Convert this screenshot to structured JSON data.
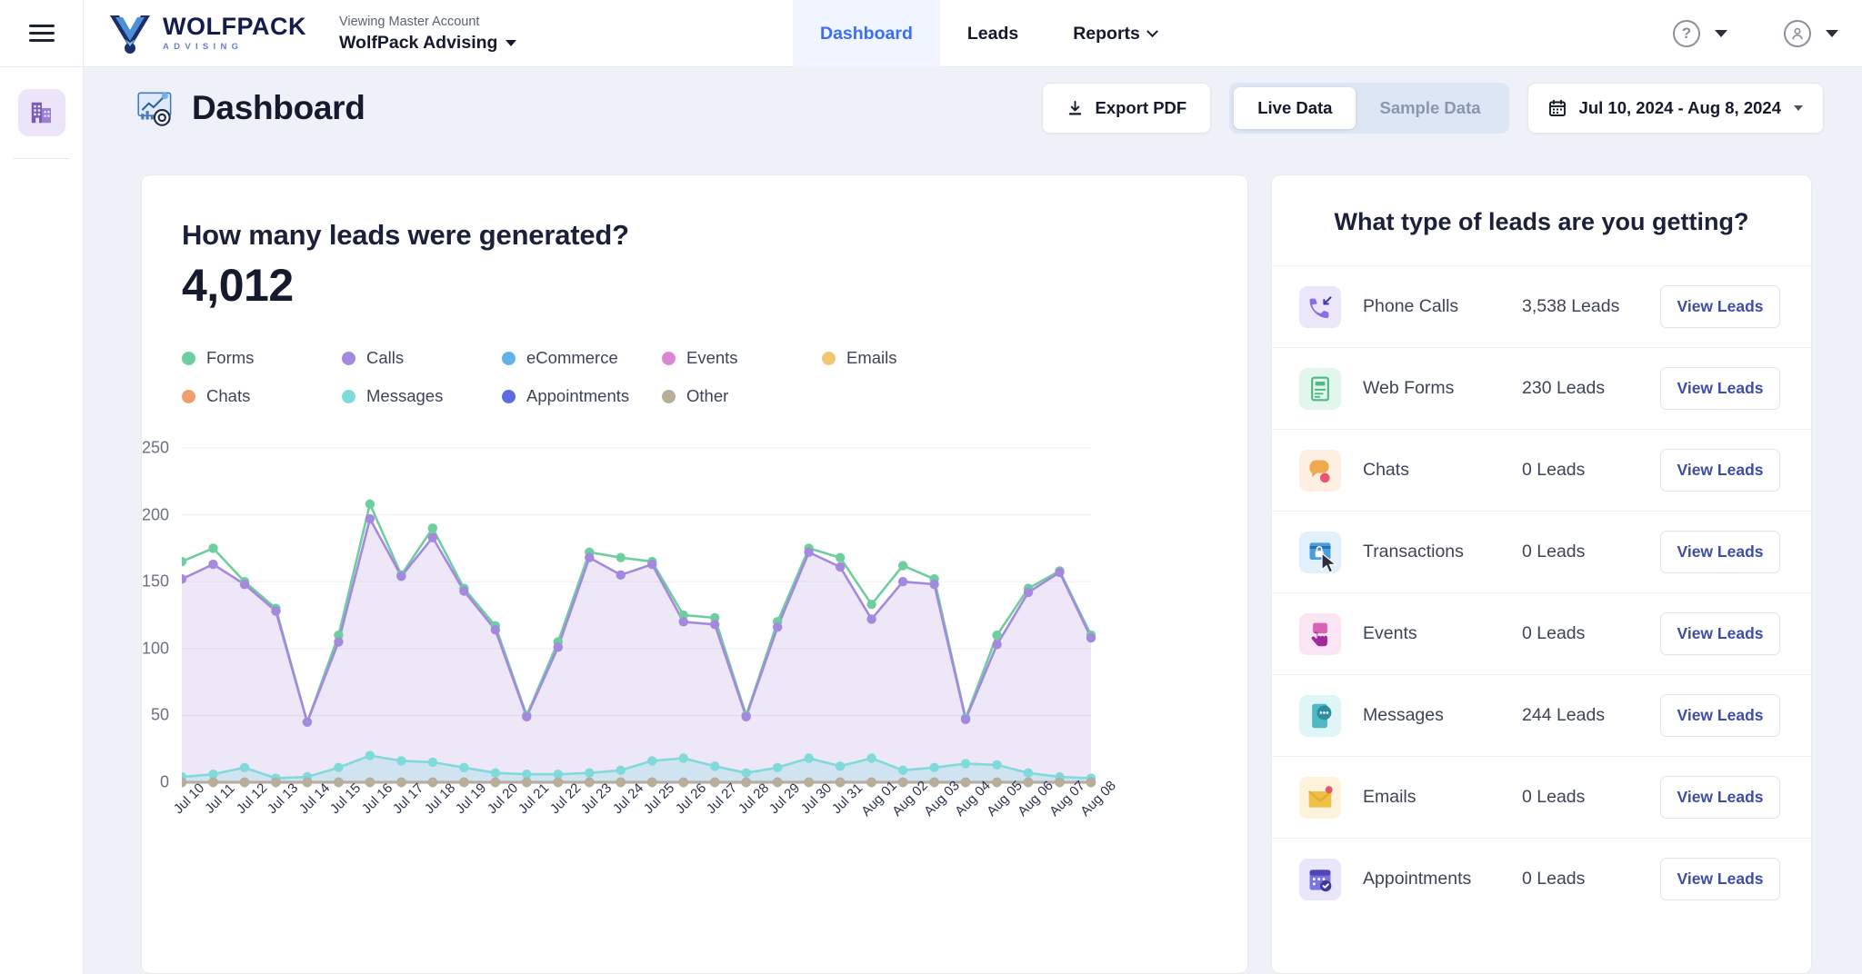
{
  "topbar": {
    "menu_icon": "hamburger-icon",
    "brand_name": "WOLFPACK",
    "brand_sub": "ADVISING",
    "viewing_label": "Viewing Master Account",
    "account_name": "WolfPack Advising",
    "nav": [
      {
        "label": "Dashboard",
        "active": true,
        "has_caret": false
      },
      {
        "label": "Leads",
        "active": false,
        "has_caret": false
      },
      {
        "label": "Reports",
        "active": false,
        "has_caret": true
      }
    ],
    "help_icon": "question-mark-icon",
    "account_icon": "user-circle-icon"
  },
  "rail": {
    "item_icon": "building-icon"
  },
  "page": {
    "title": "Dashboard",
    "title_icon": "dashboard-analytics-icon",
    "export_label": "Export PDF",
    "export_icon": "download-icon",
    "segment": {
      "live": "Live Data",
      "sample": "Sample Data",
      "selected": "Live Data"
    },
    "date_range": "Jul 10, 2024 - Aug 8, 2024",
    "calendar_icon": "calendar-icon",
    "date_caret_icon": "chevron-down-icon"
  },
  "chart_card": {
    "question": "How many leads were generated?",
    "total": "4,012"
  },
  "right_panel": {
    "title": "What type of leads are you getting?",
    "view_label": "View Leads",
    "rows": [
      {
        "name": "Phone Calls",
        "count": "3,538 Leads",
        "icon": "phone-incoming-icon",
        "bg": "#ece6fb",
        "fg": "#8b6fe0"
      },
      {
        "name": "Web Forms",
        "count": "230 Leads",
        "icon": "form-document-icon",
        "bg": "#e3f6ec",
        "fg": "#4fb884"
      },
      {
        "name": "Chats",
        "count": "0 Leads",
        "icon": "chat-bubble-icon",
        "bg": "#fdf0e2",
        "fg": "#f0a94e"
      },
      {
        "name": "Transactions",
        "count": "0 Leads",
        "icon": "transaction-card-icon",
        "bg": "#e1f0fb",
        "fg": "#4b9ede"
      },
      {
        "name": "Events",
        "count": "0 Leads",
        "icon": "event-hand-icon",
        "bg": "#fbe4f3",
        "fg": "#d764b4"
      },
      {
        "name": "Messages",
        "count": "244 Leads",
        "icon": "message-phone-icon",
        "bg": "#e0f5f6",
        "fg": "#4fb9c4"
      },
      {
        "name": "Emails",
        "count": "0 Leads",
        "icon": "envelope-icon",
        "bg": "#fdf3da",
        "fg": "#edc04a"
      },
      {
        "name": "Appointments",
        "count": "0 Leads",
        "icon": "calendar-check-icon",
        "bg": "#e9e6fb",
        "fg": "#7c74e0"
      }
    ]
  },
  "colors": {
    "accent_blue": "#3b6df6",
    "link_blue": "#3d4da8",
    "text_dark": "#151a2d",
    "page_bg": "#eef1f8"
  },
  "chart_data": {
    "type": "line",
    "title": "How many leads were generated?",
    "xlabel": "",
    "ylabel": "",
    "ylim": [
      0,
      250
    ],
    "yticks": [
      0,
      50,
      100,
      150,
      200,
      250
    ],
    "grid": true,
    "legend_position": "top",
    "area_fill": true,
    "categories": [
      "Jul 10",
      "Jul 11",
      "Jul 12",
      "Jul 13",
      "Jul 14",
      "Jul 15",
      "Jul 16",
      "Jul 17",
      "Jul 18",
      "Jul 19",
      "Jul 20",
      "Jul 21",
      "Jul 22",
      "Jul 23",
      "Jul 24",
      "Jul 25",
      "Jul 26",
      "Jul 27",
      "Jul 28",
      "Jul 29",
      "Jul 30",
      "Jul 31",
      "Aug 01",
      "Aug 02",
      "Aug 03",
      "Aug 04",
      "Aug 05",
      "Aug 06",
      "Aug 07",
      "Aug 08"
    ],
    "series": [
      {
        "name": "Forms",
        "color": "#6fce9f",
        "values": [
          165,
          175,
          150,
          130,
          45,
          110,
          208,
          155,
          190,
          145,
          117,
          50,
          105,
          172,
          168,
          165,
          125,
          123,
          50,
          120,
          175,
          168,
          133,
          162,
          152,
          48,
          110,
          145,
          158,
          110
        ]
      },
      {
        "name": "Calls",
        "color": "#a489de",
        "values": [
          152,
          163,
          148,
          128,
          45,
          105,
          197,
          154,
          183,
          143,
          114,
          49,
          101,
          168,
          155,
          163,
          120,
          118,
          49,
          116,
          172,
          161,
          122,
          150,
          148,
          47,
          103,
          142,
          157,
          108
        ]
      },
      {
        "name": "eCommerce",
        "color": "#63b3e8",
        "values": [
          0,
          0,
          0,
          0,
          0,
          0,
          0,
          0,
          0,
          0,
          0,
          0,
          0,
          0,
          0,
          0,
          0,
          0,
          0,
          0,
          0,
          0,
          0,
          0,
          0,
          0,
          0,
          0,
          0,
          0
        ]
      },
      {
        "name": "Events",
        "color": "#db86d2",
        "values": [
          0,
          0,
          0,
          0,
          0,
          0,
          0,
          0,
          0,
          0,
          0,
          0,
          0,
          0,
          0,
          0,
          0,
          0,
          0,
          0,
          0,
          0,
          0,
          0,
          0,
          0,
          0,
          0,
          0,
          0
        ]
      },
      {
        "name": "Emails",
        "color": "#f0c874",
        "values": [
          0,
          0,
          0,
          0,
          0,
          0,
          0,
          0,
          0,
          0,
          0,
          0,
          0,
          0,
          0,
          0,
          0,
          0,
          0,
          0,
          0,
          0,
          0,
          0,
          0,
          0,
          0,
          0,
          0,
          0
        ]
      },
      {
        "name": "Chats",
        "color": "#f0a06a",
        "values": [
          0,
          0,
          0,
          0,
          0,
          0,
          0,
          0,
          0,
          0,
          0,
          0,
          0,
          0,
          0,
          0,
          0,
          0,
          0,
          0,
          0,
          0,
          0,
          0,
          0,
          0,
          0,
          0,
          0,
          0
        ]
      },
      {
        "name": "Messages",
        "color": "#81dada",
        "values": [
          4,
          6,
          11,
          3,
          4,
          11,
          20,
          16,
          15,
          11,
          7,
          6,
          6,
          7,
          9,
          16,
          18,
          12,
          7,
          11,
          18,
          12,
          18,
          9,
          11,
          14,
          13,
          7,
          4,
          3
        ]
      },
      {
        "name": "Appointments",
        "color": "#5c6ce0",
        "values": [
          0,
          0,
          0,
          0,
          0,
          0,
          0,
          0,
          0,
          0,
          0,
          0,
          0,
          0,
          0,
          0,
          0,
          0,
          0,
          0,
          0,
          0,
          0,
          0,
          0,
          0,
          0,
          0,
          0,
          0
        ]
      },
      {
        "name": "Other",
        "color": "#b9ae98",
        "values": [
          0,
          0,
          0,
          0,
          0,
          0,
          0,
          0,
          0,
          0,
          0,
          0,
          0,
          0,
          0,
          0,
          0,
          0,
          0,
          0,
          0,
          0,
          0,
          0,
          0,
          0,
          0,
          0,
          0,
          0
        ]
      }
    ]
  }
}
